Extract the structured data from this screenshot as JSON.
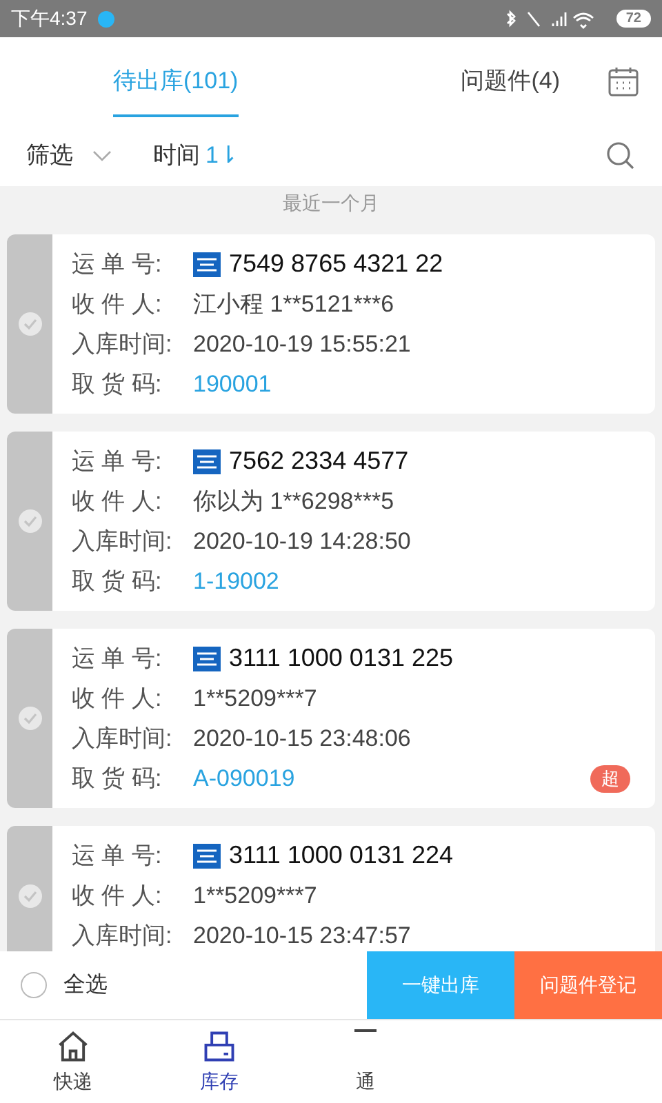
{
  "status_bar": {
    "time": "下午4:37",
    "battery": "72"
  },
  "tabs": [
    {
      "label": "待出库(101)",
      "selected": true
    },
    {
      "label": "问题件(4)",
      "selected": false
    }
  ],
  "filter": {
    "filter_label": "筛选",
    "sort_label": "时间",
    "sort_icon": "1⇂"
  },
  "section_header": "最近一个月",
  "parcels": [
    {
      "selected": false,
      "rows": [
        {
          "label": "运 单 号:",
          "value": "7549 8765 4321 22",
          "kind": "tracking"
        },
        {
          "label": "收 件 人:",
          "value": "江小程 1**5121***6",
          "kind": "plain"
        },
        {
          "label": "入库时间:",
          "value": "2020-10-19 15:55:21",
          "kind": "plain"
        },
        {
          "label": "取 货 码:",
          "value": "190001",
          "kind": "code"
        }
      ]
    },
    {
      "selected": false,
      "rows": [
        {
          "label": "运 单 号:",
          "value": "7562 2334 4577",
          "kind": "tracking"
        },
        {
          "label": "收 件 人:",
          "value": "你以为 1**6298***5",
          "kind": "plain"
        },
        {
          "label": "入库时间:",
          "value": "2020-10-19 14:28:50",
          "kind": "plain"
        },
        {
          "label": "取 货 码:",
          "value": "1-19002",
          "kind": "code"
        }
      ]
    },
    {
      "selected": false,
      "badge": "超",
      "rows": [
        {
          "label": "运 单 号:",
          "value": "3111 1000 0131 225",
          "kind": "tracking"
        },
        {
          "label": "收 件 人:",
          "value": "1**5209***7",
          "kind": "plain"
        },
        {
          "label": "入库时间:",
          "value": "2020-10-15 23:48:06",
          "kind": "plain"
        },
        {
          "label": "取 货 码:",
          "value": "A-090019",
          "kind": "code"
        }
      ]
    },
    {
      "selected": false,
      "rows": [
        {
          "label": "运 单 号:",
          "value": "3111 1000 0131 224",
          "kind": "tracking"
        },
        {
          "label": "收 件 人:",
          "value": "1**5209***7",
          "kind": "plain"
        },
        {
          "label": "入库时间:",
          "value": "2020-10-15 23:47:57",
          "kind": "plain"
        }
      ]
    }
  ],
  "action_bar": {
    "select_all": {
      "label": "全选",
      "checked": false
    },
    "buttons": [
      {
        "label": "一键出库",
        "kind": "primary"
      },
      {
        "label": "问题件登记",
        "kind": "warning"
      }
    ]
  },
  "nav": [
    {
      "label": "快递",
      "kind": "home",
      "selected": false
    },
    {
      "label": "库存",
      "kind": "printer",
      "selected": true
    },
    {
      "label": "通",
      "kind": "box",
      "selected": false
    }
  ]
}
